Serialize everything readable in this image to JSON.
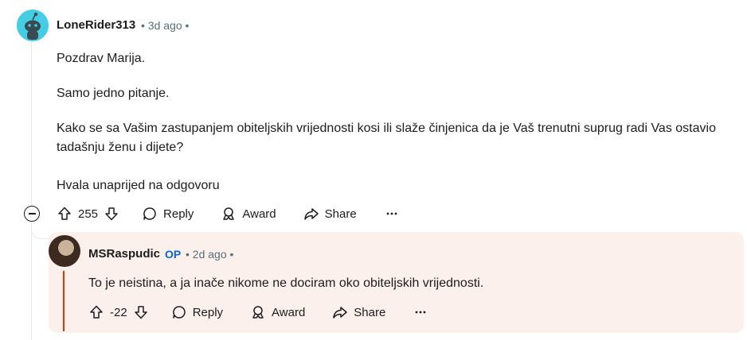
{
  "comment": {
    "author": "LoneRider313",
    "time": "3d ago",
    "paragraphs": [
      "Pozdrav Marija.",
      "Samo jedno pitanje.",
      "Kako se sa Vašim zastupanjem obiteljskih vrijednosti kosi ili slaže činjenica da je Vaš trenutni suprug radi Vas ostavio tadašnju ženu i dijete?",
      "Hvala unaprijed na odgovoru"
    ],
    "score": "255",
    "actions": {
      "reply": "Reply",
      "award": "Award",
      "share": "Share"
    }
  },
  "reply": {
    "author": "MSRaspudic",
    "op_badge": "OP",
    "time": "2d ago",
    "text": "To je neistina, a ja inače nikome ne dociram oko obiteljskih vrijednosti.",
    "score": "-22",
    "actions": {
      "reply": "Reply",
      "award": "Award",
      "share": "Share"
    }
  },
  "icons": {
    "upvote": "upvote-icon",
    "downvote": "downvote-icon",
    "reply": "comment-bubble-icon",
    "award": "award-icon",
    "share": "share-icon",
    "more": "more-dots-icon",
    "collapse": "collapse-minus-icon"
  },
  "colors": {
    "op_accent": "#d93900",
    "op_badge": "#0a66d0",
    "reply_bg": "#fcf0ec",
    "avatar_bg": "#44cde3"
  }
}
